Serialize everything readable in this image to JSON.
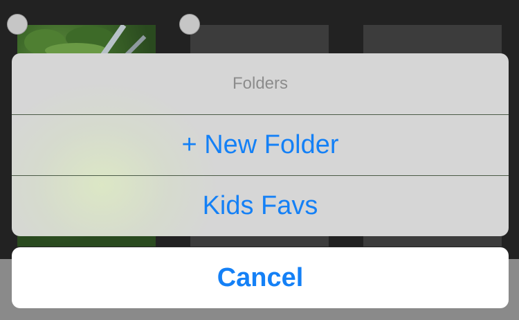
{
  "sheet": {
    "title": "Folders",
    "actions": [
      {
        "label": "+ New Folder"
      },
      {
        "label": "Kids Favs"
      }
    ],
    "cancel_label": "Cancel"
  },
  "colors": {
    "accent": "#1480f6",
    "sheet_background": "#d6d6d6",
    "title_text": "#8c8c8c",
    "backdrop": "#222222"
  }
}
